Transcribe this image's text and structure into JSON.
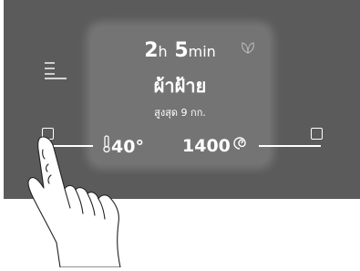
{
  "display": {
    "time_hours": "2",
    "time_hours_unit": "h",
    "time_minutes": "5",
    "time_minutes_unit": "min",
    "program_name": "ผ้าฝ้าย",
    "max_load": "สูงสุด 9 กก.",
    "temperature": "40°",
    "spin_speed": "1400"
  },
  "icons": {
    "menu": "menu-icon",
    "leaf": "eco-leaf-icon",
    "thermometer": "thermometer-icon",
    "spin": "spin-icon",
    "left_button": "square-button-icon",
    "right_button": "square-button-icon",
    "hand": "pointing-hand-icon"
  },
  "colors": {
    "panel": "#5b5b5b",
    "display": "#747474",
    "text": "#ffffff"
  }
}
